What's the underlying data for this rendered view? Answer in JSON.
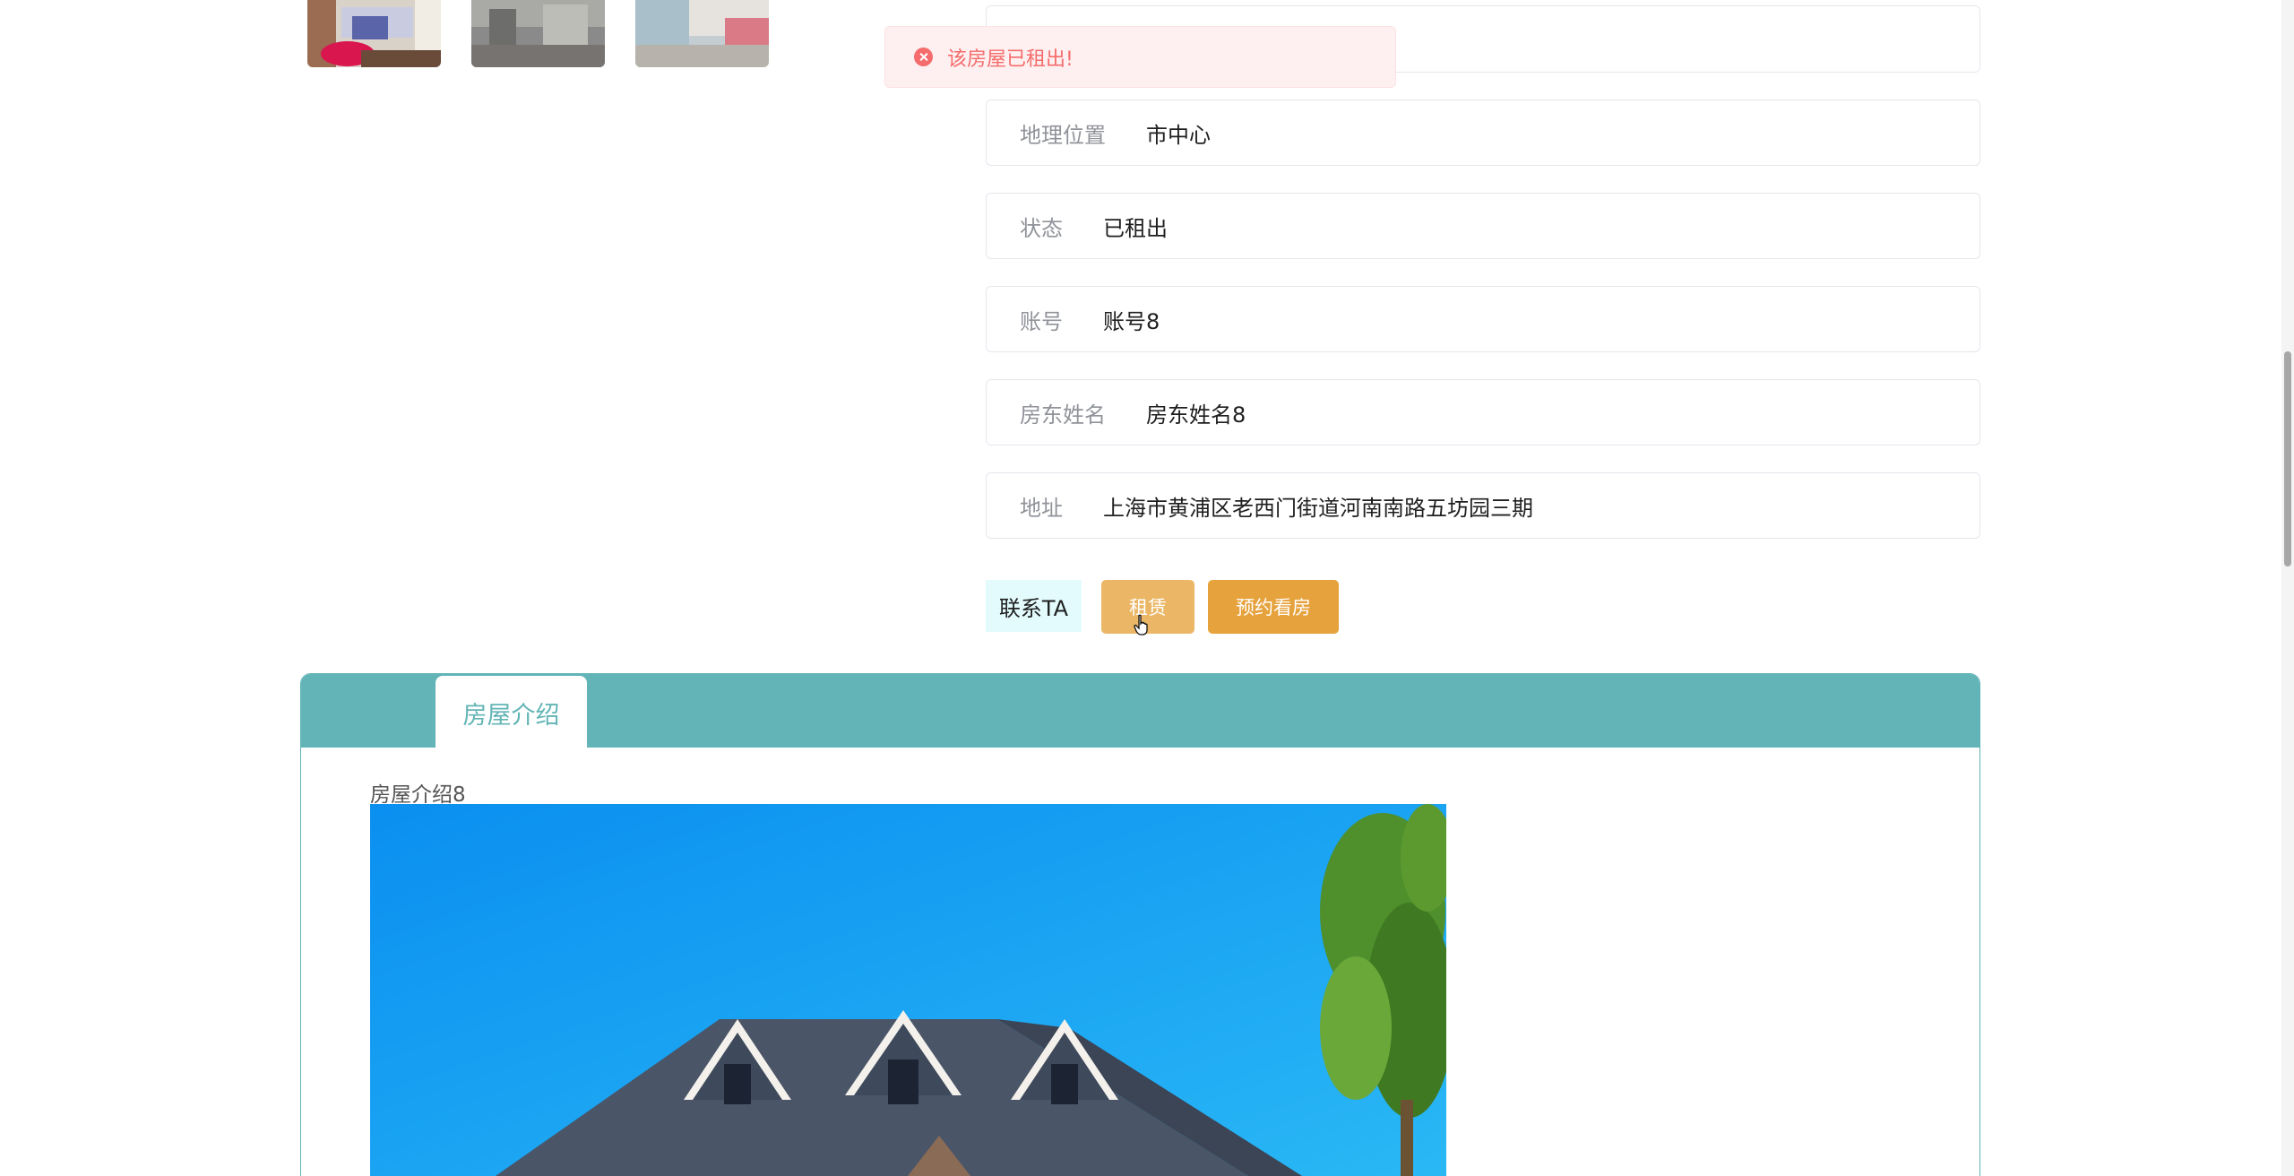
{
  "toast": {
    "message": "该房屋已租出!",
    "color": "#f56c6c"
  },
  "details": [
    {
      "label": "地理位置",
      "value": "市中心"
    },
    {
      "label": "状态",
      "value": "已租出"
    },
    {
      "label": "账号",
      "value": "账号8"
    },
    {
      "label": "房东姓名",
      "value": "房东姓名8"
    },
    {
      "label": "地址",
      "value": "上海市黄浦区老西门街道河南南路五坊园三期"
    }
  ],
  "actions": {
    "contact": "联系TA",
    "rent": "租赁",
    "viewing": "预约看房"
  },
  "tabs": [
    {
      "label": "房屋介绍"
    }
  ],
  "intro": {
    "text": "房屋介绍8"
  },
  "colors": {
    "accent": "#63b4b6",
    "rent_button": "#ebb766",
    "viewing_button": "#e6a23c",
    "contact_button": "#e3fbfd"
  }
}
